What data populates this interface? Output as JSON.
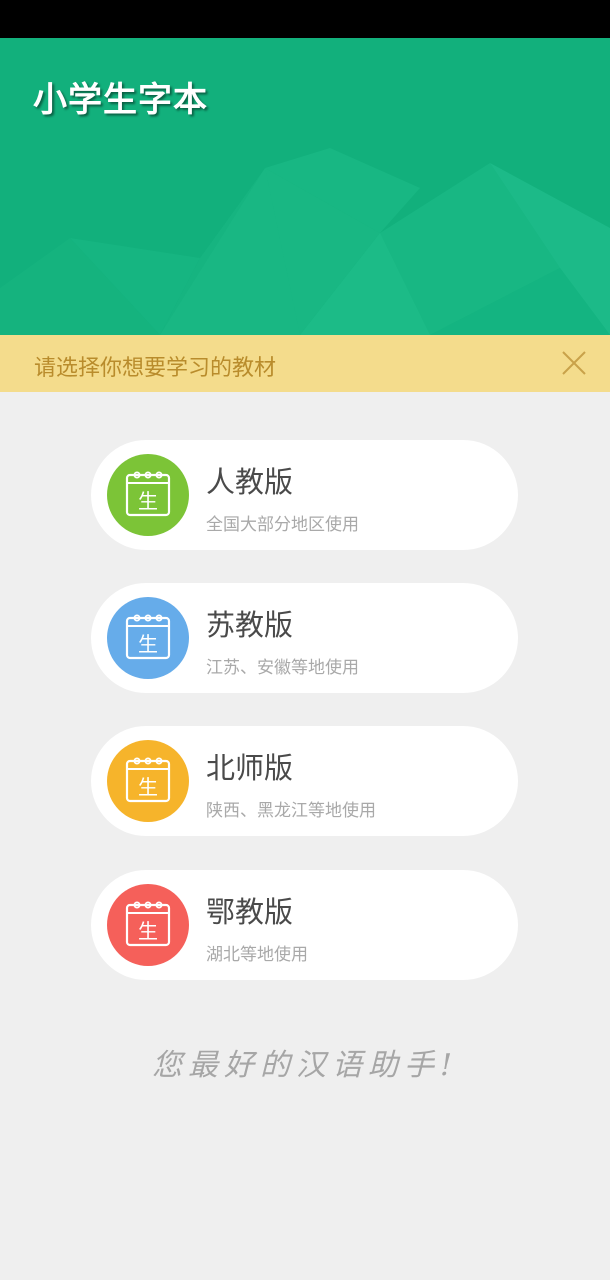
{
  "app": {
    "title": "小学生字本"
  },
  "notice": {
    "text": "请选择你想要学习的教材"
  },
  "icon_glyph": "生",
  "editions": [
    {
      "title": "人教版",
      "subtitle": "全国大部分地区使用",
      "color": "#7cc437"
    },
    {
      "title": "苏教版",
      "subtitle": "江苏、安徽等地使用",
      "color": "#66acea"
    },
    {
      "title": "北师版",
      "subtitle": "陕西、黑龙江等地使用",
      "color": "#f6b42b"
    },
    {
      "title": "鄂教版",
      "subtitle": "湖北等地使用",
      "color": "#f5605a"
    }
  ],
  "slogan": "您最好的汉语助手!",
  "colors": {
    "header": "#12b07c",
    "notice_bg": "#f4dc8c",
    "notice_text": "#b98c2c"
  }
}
